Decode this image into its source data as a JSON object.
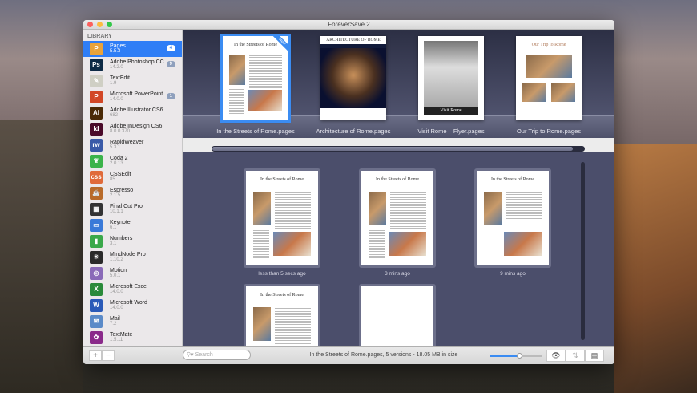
{
  "window": {
    "title": "ForeverSave 2"
  },
  "sidebar": {
    "header": "LIBRARY",
    "items": [
      {
        "name": "Pages",
        "version": "5.5.3",
        "badge": "4",
        "icon": "pages-icon",
        "color": "#e9a33a",
        "glyph": "P",
        "selected": true
      },
      {
        "name": "Adobe Photoshop CC",
        "version": "14.2.0",
        "badge": "9",
        "icon": "photoshop-icon",
        "color": "#0d2a45",
        "glyph": "Ps"
      },
      {
        "name": "TextEdit",
        "version": "1.9",
        "icon": "textedit-icon",
        "color": "#cfcfc4",
        "glyph": "✎"
      },
      {
        "name": "Microsoft PowerPoint",
        "version": "14.0.0",
        "badge": "1",
        "icon": "powerpoint-icon",
        "color": "#d24726",
        "glyph": "P"
      },
      {
        "name": "Adobe Illustrator CS6",
        "version": "682",
        "icon": "illustrator-icon",
        "color": "#4a2a06",
        "glyph": "Ai"
      },
      {
        "name": "Adobe InDesign CS6",
        "version": "8.0.0.370",
        "icon": "indesign-icon",
        "color": "#4a0a2a",
        "glyph": "Id"
      },
      {
        "name": "RapidWeaver",
        "version": "5.3.1",
        "icon": "rapidweaver-icon",
        "color": "#3a5aa8",
        "glyph": "rw"
      },
      {
        "name": "Coda 2",
        "version": "2.0.13",
        "icon": "coda-icon",
        "color": "#3bb34a",
        "glyph": "❦"
      },
      {
        "name": "CSSEdit",
        "version": "85",
        "icon": "cssedit-icon",
        "color": "#e06a3a",
        "glyph": "css"
      },
      {
        "name": "Espresso",
        "version": "2.1.5",
        "icon": "espresso-icon",
        "color": "#b86a2a",
        "glyph": "☕"
      },
      {
        "name": "Final Cut Pro",
        "version": "10.1.1",
        "icon": "finalcut-icon",
        "color": "#333",
        "glyph": "▦"
      },
      {
        "name": "Keynote",
        "version": "6.1",
        "icon": "keynote-icon",
        "color": "#3a7ad8",
        "glyph": "▭"
      },
      {
        "name": "Numbers",
        "version": "3.1",
        "icon": "numbers-icon",
        "color": "#3aa84a",
        "glyph": "▮"
      },
      {
        "name": "MindNode Pro",
        "version": "1.10.2",
        "icon": "mindnode-icon",
        "color": "#2a2a2a",
        "glyph": "✳"
      },
      {
        "name": "Motion",
        "version": "5.0.1",
        "icon": "motion-icon",
        "color": "#8a6ab8",
        "glyph": "◎"
      },
      {
        "name": "Microsoft Excel",
        "version": "14.0.0",
        "icon": "excel-icon",
        "color": "#2a8a3a",
        "glyph": "X"
      },
      {
        "name": "Microsoft Word",
        "version": "14.0.0",
        "icon": "word-icon",
        "color": "#2a5ab8",
        "glyph": "W"
      },
      {
        "name": "Mail",
        "version": "7.2",
        "icon": "mail-icon",
        "color": "#5a8ac8",
        "glyph": "✉"
      },
      {
        "name": "TextMate",
        "version": "1.5.11",
        "icon": "textmate-icon",
        "color": "#8a2a8a",
        "glyph": "✿"
      }
    ]
  },
  "shelf": {
    "documents": [
      {
        "label": "In the Streets of Rome.pages",
        "title": "In the Streets of Rome",
        "new_tag": "New",
        "selected": true
      },
      {
        "label": "Architecture of Rome.pages",
        "title": "ARCHITECTURE OF ROME"
      },
      {
        "label": "Visit Rome – Flyer.pages",
        "title": "Visit Rome"
      },
      {
        "label": "Our Trip to Rome.pages",
        "title": "Our Trip to Rome"
      }
    ]
  },
  "versions": [
    {
      "label": "less than 5 secs ago",
      "title": "In the Streets of Rome"
    },
    {
      "label": "3 mins ago",
      "title": "In the Streets of Rome"
    },
    {
      "label": "9 mins ago",
      "title": "In the Streets of Rome"
    },
    {
      "label": "",
      "title": "In the Streets of Rome"
    },
    {
      "label": "",
      "title": ""
    }
  ],
  "bottom": {
    "add": "+",
    "remove": "−",
    "search_placeholder": "Search",
    "status": "In the Streets of Rome.pages, 5 versions - 18.05 MB in size",
    "zoom_level": 0.55
  },
  "colors": {
    "accent": "#2f7ef6",
    "shelf": "#4b4e6b"
  }
}
